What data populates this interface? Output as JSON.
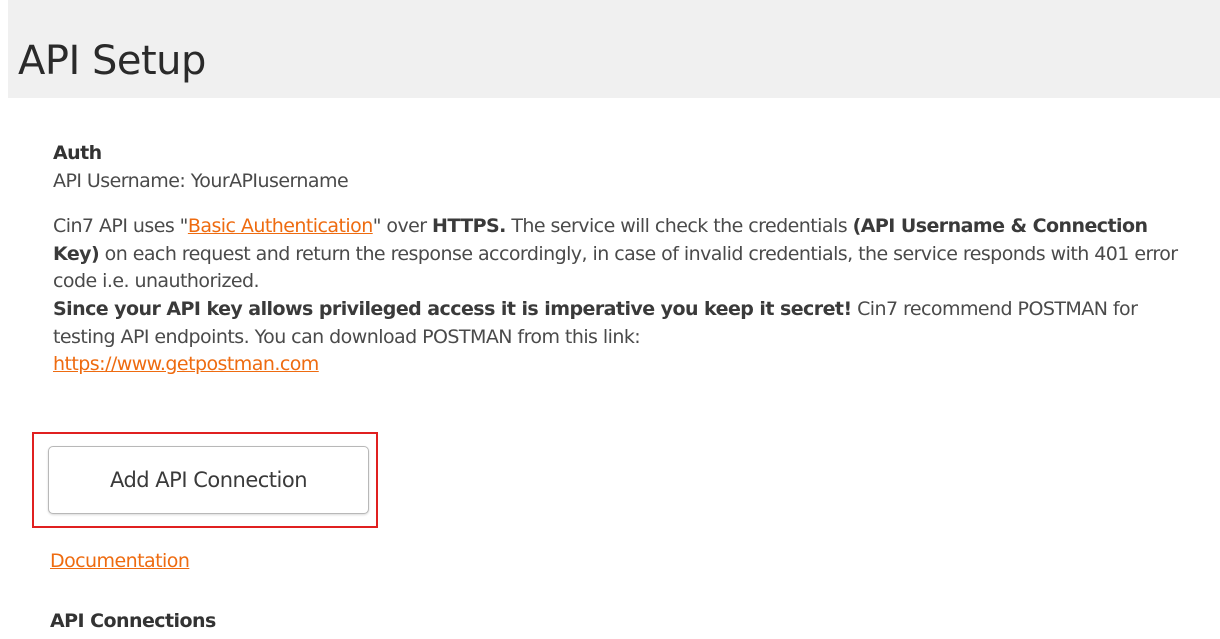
{
  "header": {
    "title": "API Setup"
  },
  "auth": {
    "title": "Auth",
    "username_label": "API Username:",
    "username_value": "YourAPIusername"
  },
  "description": {
    "p1_a": "Cin7 API uses \"",
    "basic_auth_link": "Basic Authentication",
    "p1_b": "\" over ",
    "https": "HTTPS.",
    "p1_c": " The service will check the credentials ",
    "credentials_bold": "(API Username & Connection Key)",
    "p1_d": " on each request and return the response accordingly, in case of invalid credentials, the service responds with 401 error code i.e. unauthorized.",
    "warning_bold": "Since your API key allows privileged access it is imperative you keep it secret!",
    "p2": " Cin7 recommend POSTMAN for testing API endpoints. You can download POSTMAN from this link:",
    "postman_link": "https://www.getpostman.com"
  },
  "actions": {
    "add_connection_label": "Add API Connection"
  },
  "links": {
    "documentation": "Documentation"
  },
  "connections": {
    "title": "API Connections"
  },
  "colors": {
    "link": "#ee6b10",
    "highlight_border": "#e02020",
    "header_bg": "#f0f0f0"
  }
}
